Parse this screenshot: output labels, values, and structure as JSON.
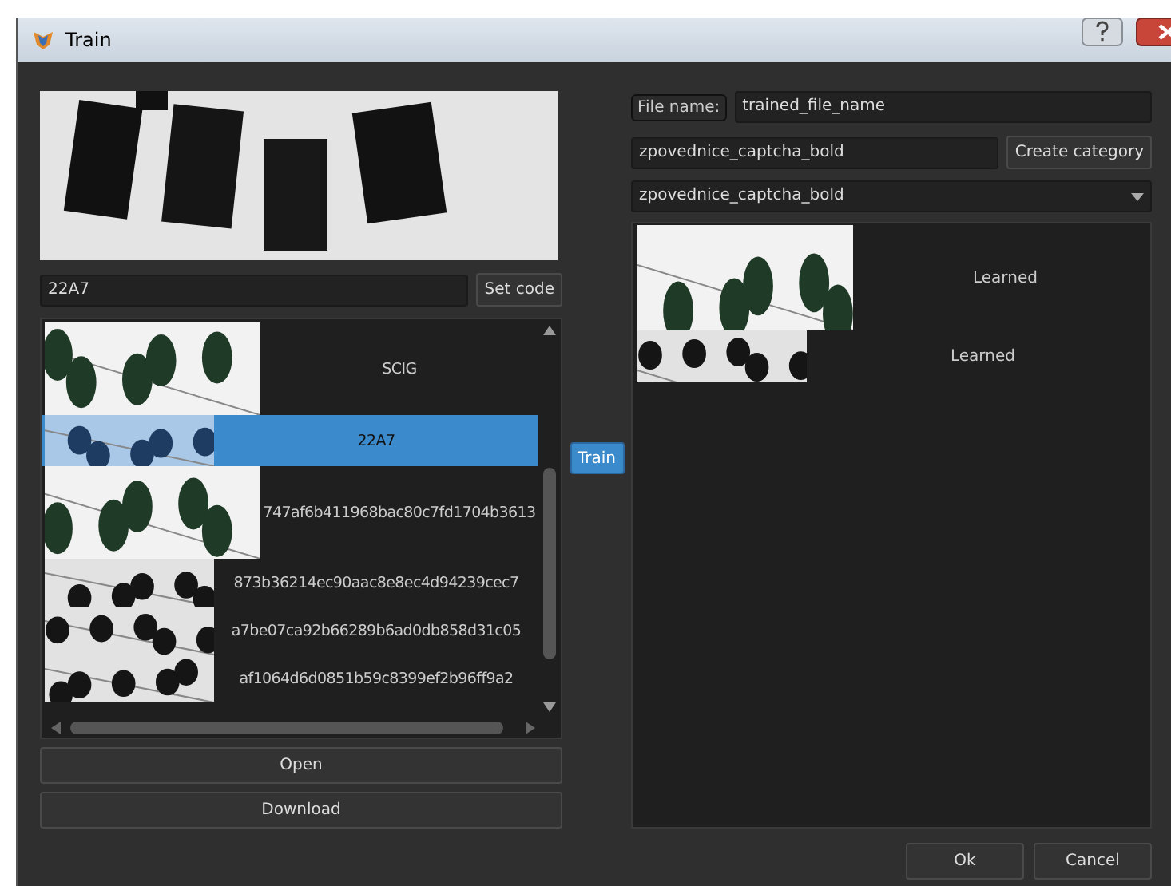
{
  "window": {
    "title": "Train"
  },
  "code_field": {
    "value": "22A7"
  },
  "set_code_button": "Set code",
  "samples": [
    {
      "code": "SCIG",
      "selected": false,
      "kind": "large"
    },
    {
      "code": "22A7",
      "selected": true,
      "kind": "wide"
    },
    {
      "code": "747af6b411968bac80c7fd1704b3613",
      "selected": false,
      "kind": "large"
    },
    {
      "code": "873b36214ec90aac8e8ec4d94239cec7",
      "selected": false,
      "kind": "small"
    },
    {
      "code": "a7be07ca92b66289b6ad0db858d31c05",
      "selected": false,
      "kind": "small"
    },
    {
      "code": "af1064d6d0851b59c8399ef2b96ff9a2",
      "selected": false,
      "kind": "small"
    }
  ],
  "train_button": "Train",
  "open_button": "Open",
  "download_button": "Download",
  "file_name": {
    "label": "File name:",
    "value": "trained_file_name"
  },
  "category_field": {
    "value": "zpovednice_captcha_bold"
  },
  "create_category_button": "Create category",
  "category_select": {
    "value": "zpovednice_captcha_bold"
  },
  "learned": [
    {
      "status": "Learned",
      "kind": "large"
    },
    {
      "status": "Learned",
      "kind": "small"
    }
  ],
  "buttons": [
    "Ok",
    "Cancel"
  ]
}
